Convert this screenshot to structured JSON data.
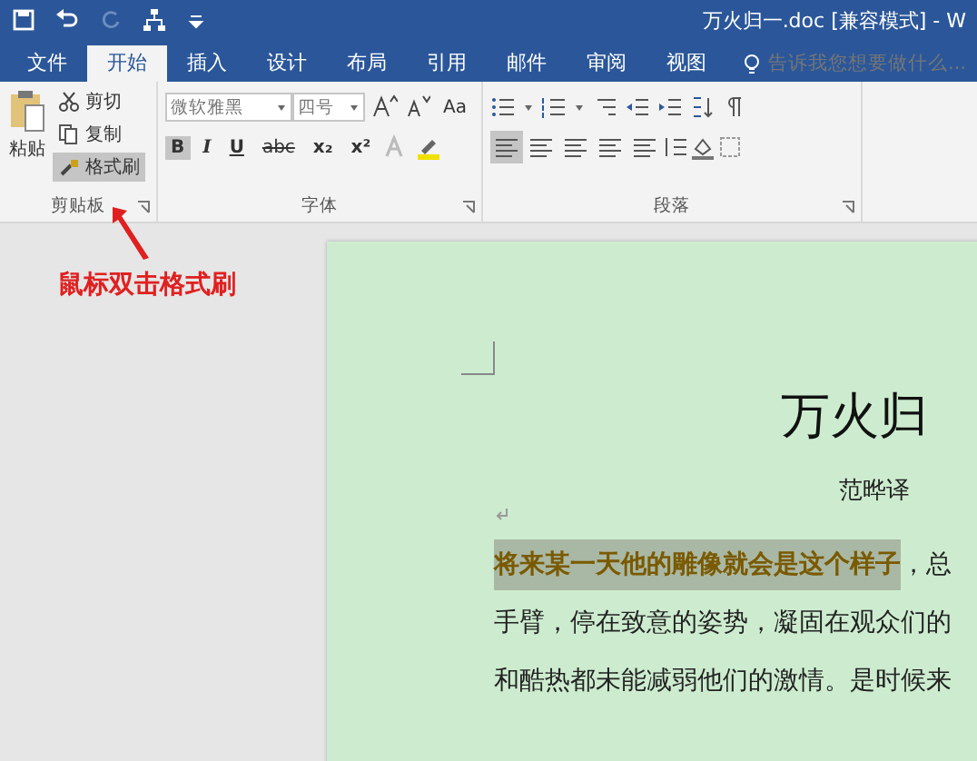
{
  "window": {
    "title": "万火归一.doc [兼容模式] - W"
  },
  "tabs": [
    {
      "label": "文件",
      "selected": false
    },
    {
      "label": "开始",
      "selected": true
    },
    {
      "label": "插入",
      "selected": false
    },
    {
      "label": "设计",
      "selected": false
    },
    {
      "label": "布局",
      "selected": false
    },
    {
      "label": "引用",
      "selected": false
    },
    {
      "label": "邮件",
      "selected": false
    },
    {
      "label": "审阅",
      "selected": false
    },
    {
      "label": "视图",
      "selected": false
    }
  ],
  "tell_me": {
    "placeholder": "告诉我您想要做什么..."
  },
  "clipboard": {
    "paste": "粘贴",
    "cut": "剪切",
    "copy": "复制",
    "format_painter": {
      "label": "格式刷",
      "selected": true
    },
    "group_label": "剪贴板"
  },
  "font": {
    "name": "微软雅黑",
    "size": "四号",
    "case": "Aa",
    "bold": {
      "label": "B",
      "selected": true
    },
    "italic": "I",
    "underline": "U",
    "strike": "abc",
    "subscript": "x₂",
    "superscript": "x²",
    "group_label": "字体"
  },
  "paragraph": {
    "alignments": [
      {
        "selected": true
      },
      {
        "selected": false
      },
      {
        "selected": false
      },
      {
        "selected": false
      },
      {
        "selected": false
      }
    ],
    "group_label": "段落"
  },
  "annotation": "鼠标双击格式刷",
  "document": {
    "title": "万火归",
    "author": "范晔译",
    "first_line": {
      "highlighted": "将来某一天他的雕像就会是这个样子",
      "text": "，总"
    },
    "lines": [
      "手臂，停在致意的姿势，凝固在观众们的",
      "和酷热都未能减弱他们的激情。是时候来"
    ]
  }
}
